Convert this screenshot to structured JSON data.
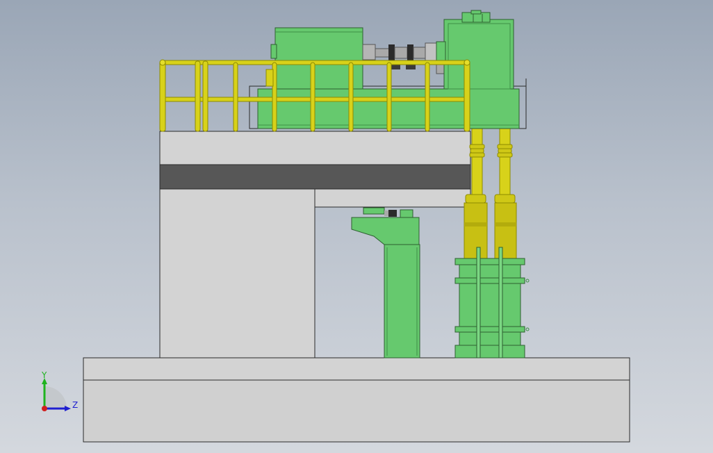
{
  "viewport": {
    "background_top": "#9aa6b6",
    "background_bottom": "#d4d8de"
  },
  "model": {
    "part_colors": {
      "concrete": "#d3d3d3",
      "concrete_edge": "#2a2a2a",
      "dark_band": "#575757",
      "machine_green": "#66c96e",
      "machine_green_dark": "#3f8f47",
      "railing_yellow": "#d8d21a",
      "railing_yellow_dark": "#8d8a00",
      "steel_grey": "#a9a9a9",
      "steel_dark": "#2b2b2b"
    }
  },
  "triad": {
    "y_label": "Y",
    "z_label": "Z",
    "y_color": "#1fb31f",
    "z_color": "#1f1fd0",
    "x_origin_color": "#d01f1f"
  }
}
